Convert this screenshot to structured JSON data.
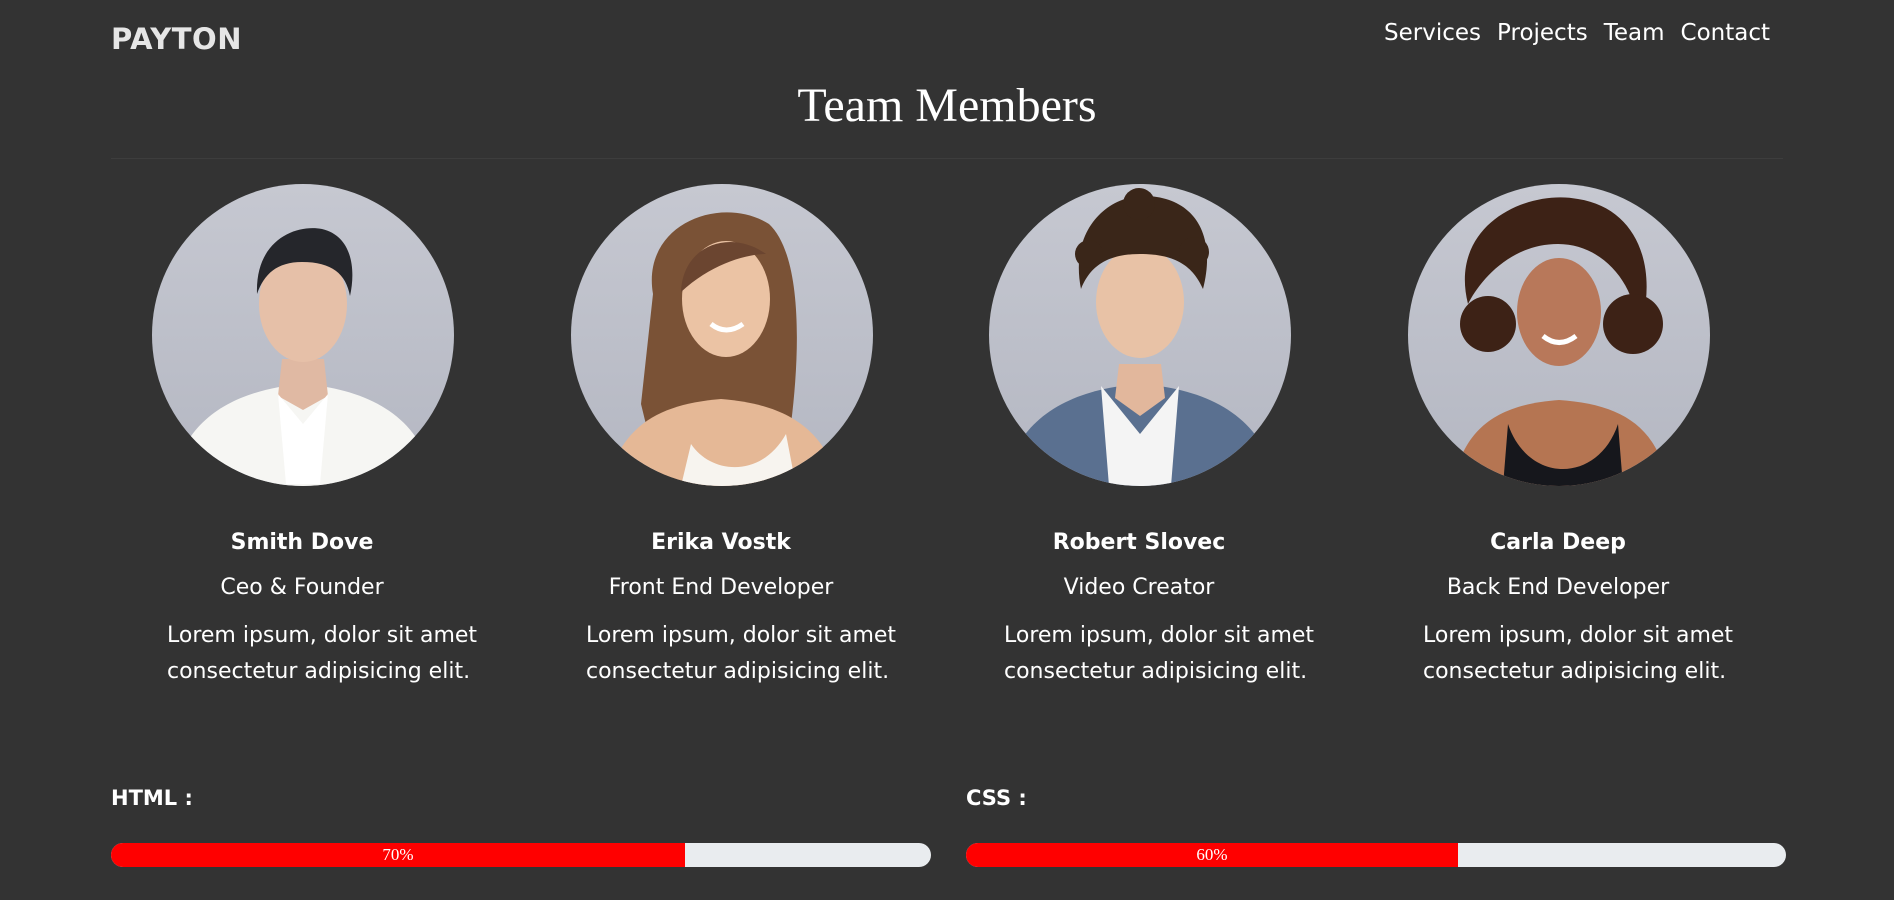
{
  "brand": "PAYTON",
  "nav": [
    "Services",
    "Projects",
    "Team",
    "Contact"
  ],
  "section_title": "Team Members",
  "members": [
    {
      "name": "Smith Dove",
      "role": "Ceo & Founder",
      "bio_line1": "Lorem ipsum, dolor sit amet",
      "bio_line2": "consectetur adipisicing elit.",
      "photo": "man-white-shirt-photo"
    },
    {
      "name": "Erika Vostk",
      "role": "Front End Developer",
      "bio_line1": "Lorem ipsum, dolor sit amet",
      "bio_line2": "consectetur adipisicing elit.",
      "photo": "woman-long-hair-photo"
    },
    {
      "name": "Robert Slovec",
      "role": "Video Creator",
      "bio_line1": "Lorem ipsum, dolor sit amet",
      "bio_line2": "consectetur adipisicing elit.",
      "photo": "man-curly-hair-blazer-photo"
    },
    {
      "name": "Carla Deep",
      "role": "Back End Developer",
      "bio_line1": "Lorem ipsum, dolor sit amet",
      "bio_line2": "consectetur adipisicing elit.",
      "photo": "woman-curly-hair-photo"
    }
  ],
  "skills": [
    {
      "label": "HTML :",
      "percent": 70,
      "percent_text": "70%"
    },
    {
      "label": "CSS :",
      "percent": 60,
      "percent_text": "60%"
    }
  ],
  "colors": {
    "background": "#333333",
    "progress_fill": "#ff0000",
    "progress_track": "#e9ecef",
    "text": "#ffffff"
  }
}
